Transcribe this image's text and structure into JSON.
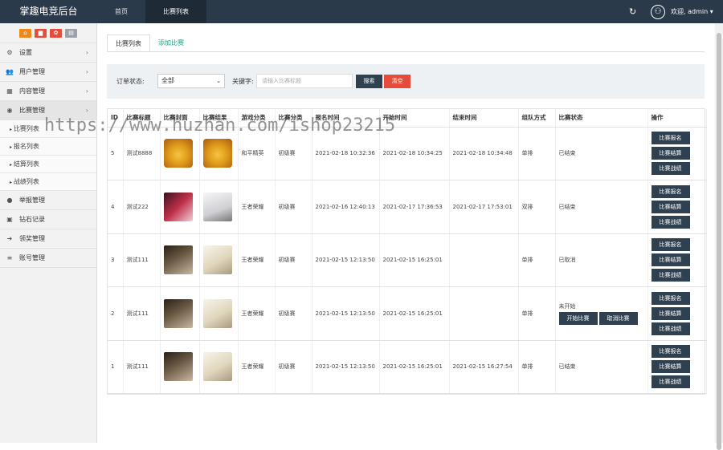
{
  "app": {
    "brand": "掌趣电竞后台",
    "welcome": "欢迎, admin ▾"
  },
  "topnav": [
    "首页",
    "比赛列表"
  ],
  "sidebar": {
    "quick": [
      {
        "icon": "home-icon",
        "color": "#f0891c",
        "glyph": "⌂"
      },
      {
        "icon": "trash-icon",
        "color": "#e64c3c",
        "glyph": "▆"
      },
      {
        "icon": "gear-icon",
        "color": "#e64c3c",
        "glyph": "✿"
      },
      {
        "icon": "list-icon",
        "color": "#9aa1a8",
        "glyph": "▤"
      }
    ],
    "items": [
      {
        "label": "设置",
        "icon": "settings-icon",
        "glyph": "⚙"
      },
      {
        "label": "用户管理",
        "icon": "users-icon",
        "glyph": "👥"
      },
      {
        "label": "内容管理",
        "icon": "grid-icon",
        "glyph": "▦"
      },
      {
        "label": "比赛管理",
        "icon": "eye-icon",
        "glyph": "◉"
      }
    ],
    "sub": [
      "比赛列表",
      "报名列表",
      "结算列表",
      "战绩列表"
    ],
    "items2": [
      {
        "label": "举报管理",
        "icon": "comment-icon",
        "glyph": "●"
      },
      {
        "label": "钻石记录",
        "icon": "money-icon",
        "glyph": "▣"
      },
      {
        "label": "领奖管理",
        "icon": "signin-icon",
        "glyph": "➜"
      },
      {
        "label": "账号管理",
        "icon": "menu-icon",
        "glyph": "≡"
      }
    ]
  },
  "tabs": [
    "比赛列表",
    "添加比赛"
  ],
  "filter": {
    "status_label": "订单状态:",
    "status_value": "全部",
    "keyword_label": "关键字:",
    "keyword_placeholder": "请输入比赛标题",
    "search_btn": "搜索",
    "clear_btn": "清空"
  },
  "table": {
    "headers": [
      "ID",
      "比赛标题",
      "比赛封面",
      "比赛结果",
      "游戏分类",
      "比赛分类",
      "报名时间",
      "开始时间",
      "结束时间",
      "组队方式",
      "比赛状态",
      "操作"
    ],
    "ops": [
      "比赛报名",
      "比赛结算",
      "比赛战绩"
    ],
    "start_btn": "开始比赛",
    "cancel_btn": "取消比赛",
    "rows": [
      {
        "id": "5",
        "title": "测试8888",
        "cover": "a1",
        "result": "a1",
        "game": "和平精英",
        "cat": "初级赛",
        "reg": "2021-02-18 10:32:36",
        "start": "2021-02-18 10:34:25",
        "end": "2021-02-18 10:34:48",
        "team": "单排",
        "status": "已结束",
        "actions": false
      },
      {
        "id": "4",
        "title": "测试222",
        "cover": "a2",
        "result": "a3",
        "game": "王者荣耀",
        "cat": "初级赛",
        "reg": "2021-02-16 12:40:13",
        "start": "2021-02-17 17:36:53",
        "end": "2021-02-17 17:53:01",
        "team": "双排",
        "status": "已结束",
        "actions": false
      },
      {
        "id": "3",
        "title": "测试111",
        "cover": "a4",
        "result": "a5",
        "game": "王者荣耀",
        "cat": "初级赛",
        "reg": "2021-02-15 12:13:50",
        "start": "2021-02-15 16:25:01",
        "end": "",
        "team": "单排",
        "status": "已取消",
        "actions": false
      },
      {
        "id": "2",
        "title": "测试111",
        "cover": "a4",
        "result": "a5",
        "game": "王者荣耀",
        "cat": "初级赛",
        "reg": "2021-02-15 12:13:50",
        "start": "2021-02-15 16:25:01",
        "end": "",
        "team": "单排",
        "status": "未开始",
        "actions": true
      },
      {
        "id": "1",
        "title": "测试111",
        "cover": "a4",
        "result": "a5",
        "game": "王者荣耀",
        "cat": "初级赛",
        "reg": "2021-02-15 12:13:50",
        "start": "2021-02-15 16:25:01",
        "end": "2021-02-15 16:27:54",
        "team": "单排",
        "status": "已结束",
        "actions": false
      }
    ]
  },
  "watermark": "https://www.huzhan.com/ishop23215",
  "colors": {
    "topbar": "#2b3a4a",
    "accent": "#18a689",
    "op_btn": "#2f4050",
    "search": "#2f4050",
    "clear": "#e64c3c"
  }
}
